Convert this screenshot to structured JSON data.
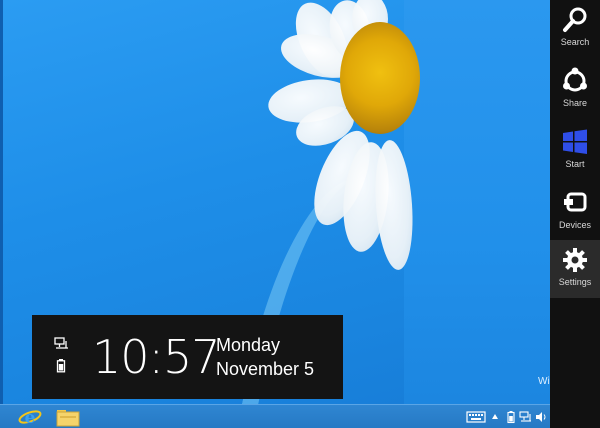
{
  "charms": [
    {
      "label": "Search",
      "icon": "search-icon"
    },
    {
      "label": "Share",
      "icon": "share-icon"
    },
    {
      "label": "Start",
      "icon": "windows-logo-icon"
    },
    {
      "label": "Devices",
      "icon": "devices-icon"
    },
    {
      "label": "Settings",
      "icon": "gear-icon"
    }
  ],
  "clock": {
    "time": "10:57",
    "day": "Monday",
    "date": "November 5"
  },
  "watermark": "Wi",
  "taskbar": {
    "pinned": [
      {
        "icon": "internet-explorer-icon"
      },
      {
        "icon": "file-explorer-icon"
      }
    ],
    "tray": [
      "keyboard-icon",
      "chevron-up-icon",
      "battery-icon",
      "network-icon",
      "volume-icon"
    ]
  },
  "colors": {
    "charms_bg": "#111111",
    "start_logo": "#2f4ee8",
    "desktop_blue": "#1e8ee8"
  }
}
